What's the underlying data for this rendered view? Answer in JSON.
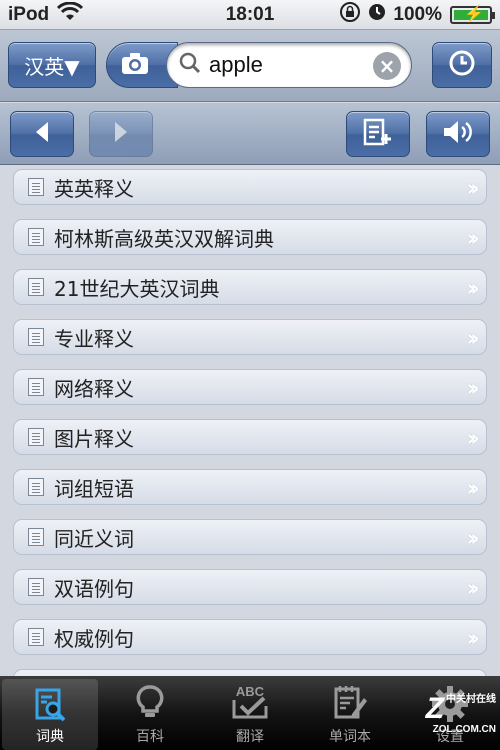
{
  "status_bar": {
    "carrier": "iPod",
    "time": "18:01",
    "battery": "100%"
  },
  "search_bar": {
    "language_label": "汉英▼",
    "query": "apple"
  },
  "list": {
    "items": [
      {
        "label": "英英释义"
      },
      {
        "label": "柯林斯高级英汉双解词典"
      },
      {
        "label": "21世纪大英汉词典"
      },
      {
        "label": "专业释义"
      },
      {
        "label": "网络释义"
      },
      {
        "label": "图片释义"
      },
      {
        "label": "词组短语"
      },
      {
        "label": "同近义词"
      },
      {
        "label": "双语例句"
      },
      {
        "label": "权威例句"
      }
    ]
  },
  "tab_bar": {
    "tabs": [
      {
        "label": "词典",
        "icon": "dictionary-search-icon",
        "active": true
      },
      {
        "label": "百科",
        "icon": "lightbulb-icon",
        "active": false
      },
      {
        "label": "翻译",
        "icon": "abc-check-icon",
        "active": false
      },
      {
        "label": "单词本",
        "icon": "notebook-pencil-icon",
        "active": false
      },
      {
        "label": "设置",
        "icon": "gear-icon",
        "active": false
      }
    ]
  },
  "watermark": {
    "line1": "中关村在线",
    "line2": "ZOL.COM.CN"
  },
  "colors": {
    "accent_blue": "#4e6fa6",
    "tab_bar": "#141414",
    "list_bg": "#d3d8e0"
  }
}
